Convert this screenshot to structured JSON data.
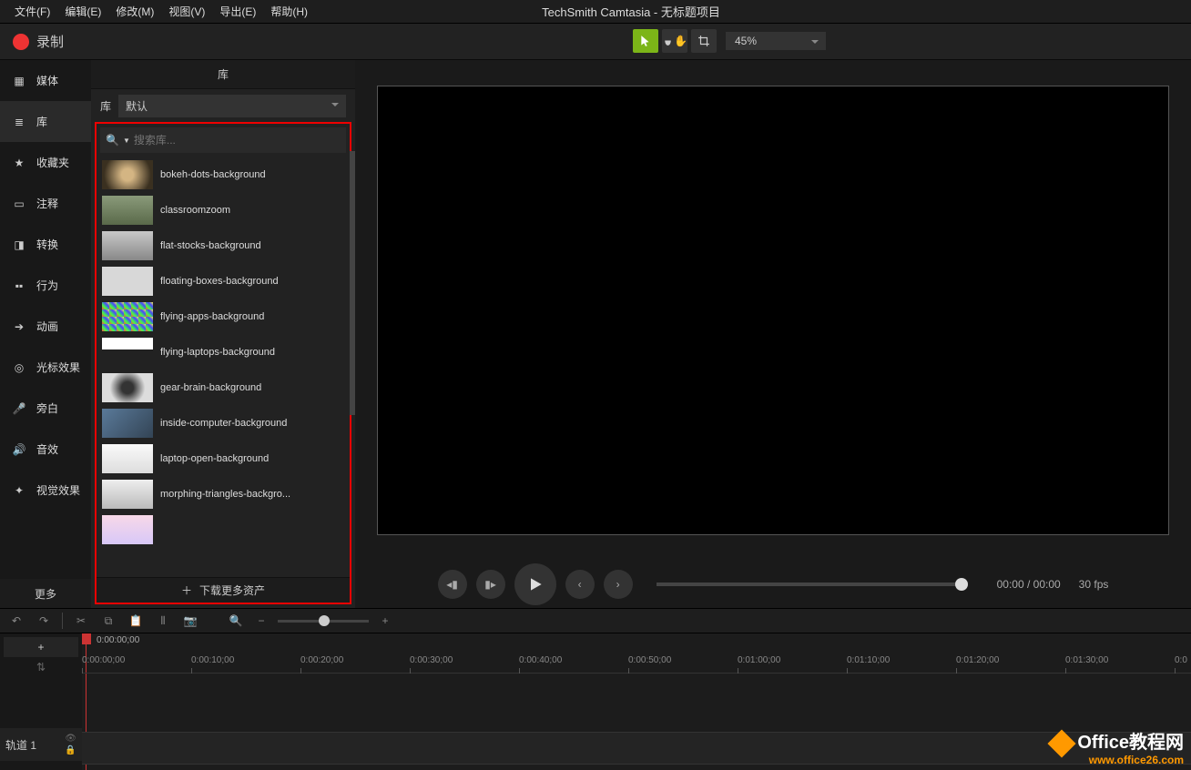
{
  "app_title": "TechSmith Camtasia - 无标题项目",
  "menu": {
    "file": "文件(F)",
    "edit": "编辑(E)",
    "modify": "修改(M)",
    "view": "视图(V)",
    "export": "导出(E)",
    "help": "帮助(H)"
  },
  "record_label": "录制",
  "zoom_value": "45%",
  "sidebar": {
    "media": "媒体",
    "library": "库",
    "fav": "收藏夹",
    "annot": "注释",
    "trans": "转换",
    "behav": "行为",
    "anim": "动画",
    "cursor": "光标效果",
    "voice": "旁白",
    "audio": "音效",
    "visual": "视觉效果",
    "more": "更多"
  },
  "panel": {
    "title": "库",
    "lib_label": "库",
    "lib_default": "默认",
    "search_ph": "搜索库...",
    "download_more": "下载更多资产"
  },
  "library_items": [
    {
      "name": "bokeh-dots-background"
    },
    {
      "name": "classroomzoom"
    },
    {
      "name": "flat-stocks-background"
    },
    {
      "name": "floating-boxes-background"
    },
    {
      "name": "flying-apps-background"
    },
    {
      "name": "flying-laptops-background"
    },
    {
      "name": "gear-brain-background"
    },
    {
      "name": "inside-computer-background"
    },
    {
      "name": "laptop-open-background"
    },
    {
      "name": "morphing-triangles-backgro..."
    }
  ],
  "playback": {
    "time": "00:00 / 00:00",
    "fps": "30 fps"
  },
  "timeline": {
    "playhead_time": "0:00:00;00",
    "ticks": [
      "0:00:00;00",
      "0:00:10;00",
      "0:00:20;00",
      "0:00:30;00",
      "0:00:40;00",
      "0:00:50;00",
      "0:01:00;00",
      "0:01:10;00",
      "0:01:20;00",
      "0:01:30;00",
      "0:0"
    ],
    "track1": "轨道 1"
  },
  "watermark": {
    "l1a": "Office",
    "l1b": "教程网",
    "l2": "www.office26.com"
  }
}
